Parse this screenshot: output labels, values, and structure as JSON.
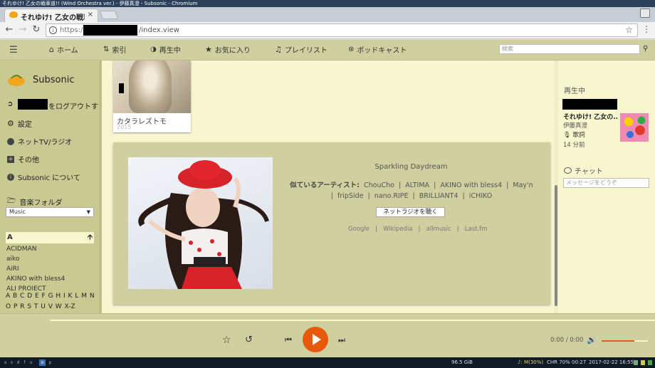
{
  "window": {
    "title": "それゆけ! 乙女の戦車道!! (Wind Orchestra ver.) - 伊藤真澄 - Subsonic - Chromium"
  },
  "tab": {
    "title": "それゆけ! 乙女の戦車",
    "close": "×"
  },
  "address": {
    "scheme": "https://",
    "path": "/index.view"
  },
  "nav": {
    "home": "ホーム",
    "index": "索引",
    "now_playing": "再生中",
    "favorites": "お気に入り",
    "playlists": "プレイリスト",
    "podcasts": "ポッドキャスト",
    "search_placeholder": "検索"
  },
  "sidebar": {
    "app_name": "Subsonic",
    "logout": "をログアウトす",
    "settings": "設定",
    "radio": "ネットTV/ラジオ",
    "more": "その他",
    "about": "Subsonic について",
    "music_folder_label": "音楽フォルダ",
    "music_folder_selected": "Music",
    "letter": "A",
    "artists": [
      "ACIDMAN",
      "aiko",
      "AiRI",
      "AKINO with bless4",
      "ALI PROJECT"
    ],
    "alphabet": "A B C D E F G H I K L M N O P R S T U V W X-Z"
  },
  "album": {
    "title": "カタラレズトモ",
    "year": "2015"
  },
  "artist_info": {
    "name": "Sparkling Daydream",
    "similar_label": "似ているアーティスト:",
    "similar": [
      "ChouCho",
      "ALTIMA",
      "AKINO with bless4",
      "May'n",
      "fripSide",
      "nano.RIPE",
      "BRILLIANT4",
      "iCHIKO"
    ],
    "radio_button": "ネットラジオを聴く",
    "links": [
      "Google",
      "Wikipedia",
      "allmusic",
      "Last.fm"
    ]
  },
  "now_playing_panel": {
    "label": "再生中",
    "title": "それゆけ! 乙女の...",
    "artist": "伊藤真澄",
    "lyrics": "歌詞",
    "time": "14 分前"
  },
  "chat": {
    "label": "チャット",
    "placeholder": "メッセージをどうぞ"
  },
  "player": {
    "time": "0:00 / 0:00",
    "volume_fraction": 0.7
  },
  "taskbar": {
    "workspaces": [
      "a",
      "s",
      "d",
      "f",
      "u",
      "o",
      "p"
    ],
    "disk": "96.5 GiB",
    "music": "♪: M(30%)",
    "chr": "CHR 70% 00:27",
    "datetime": "2017-02-22 16:55"
  },
  "colors": {
    "accent": "#e8590c",
    "navbar": "#cfcfa0",
    "background": "#f7f6cf"
  }
}
